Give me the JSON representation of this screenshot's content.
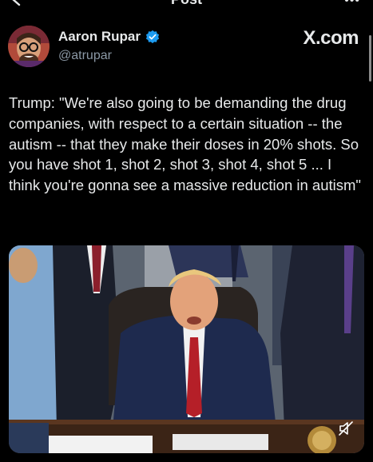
{
  "topbar": {
    "title": "Post"
  },
  "post": {
    "author_name": "Aaron Rupar",
    "author_handle": "@atrupar",
    "source_label": "X.com",
    "text": "Trump: \"We're also going to be demanding the drug companies, with respect to a certain situation -- the autism -- that they make their doses in 20% shots. So you have shot 1, shot 2, shot 3, shot 4, shot 5 ... I think you're gonna see a massive reduction in autism\""
  },
  "colors": {
    "background": "#000000",
    "text": "#e7e9ea",
    "secondary_text": "#8b98a5",
    "verified": "#1d9bf0"
  },
  "icons": [
    "back-arrow-icon",
    "more-icon",
    "verified-badge-icon",
    "mute-icon"
  ]
}
